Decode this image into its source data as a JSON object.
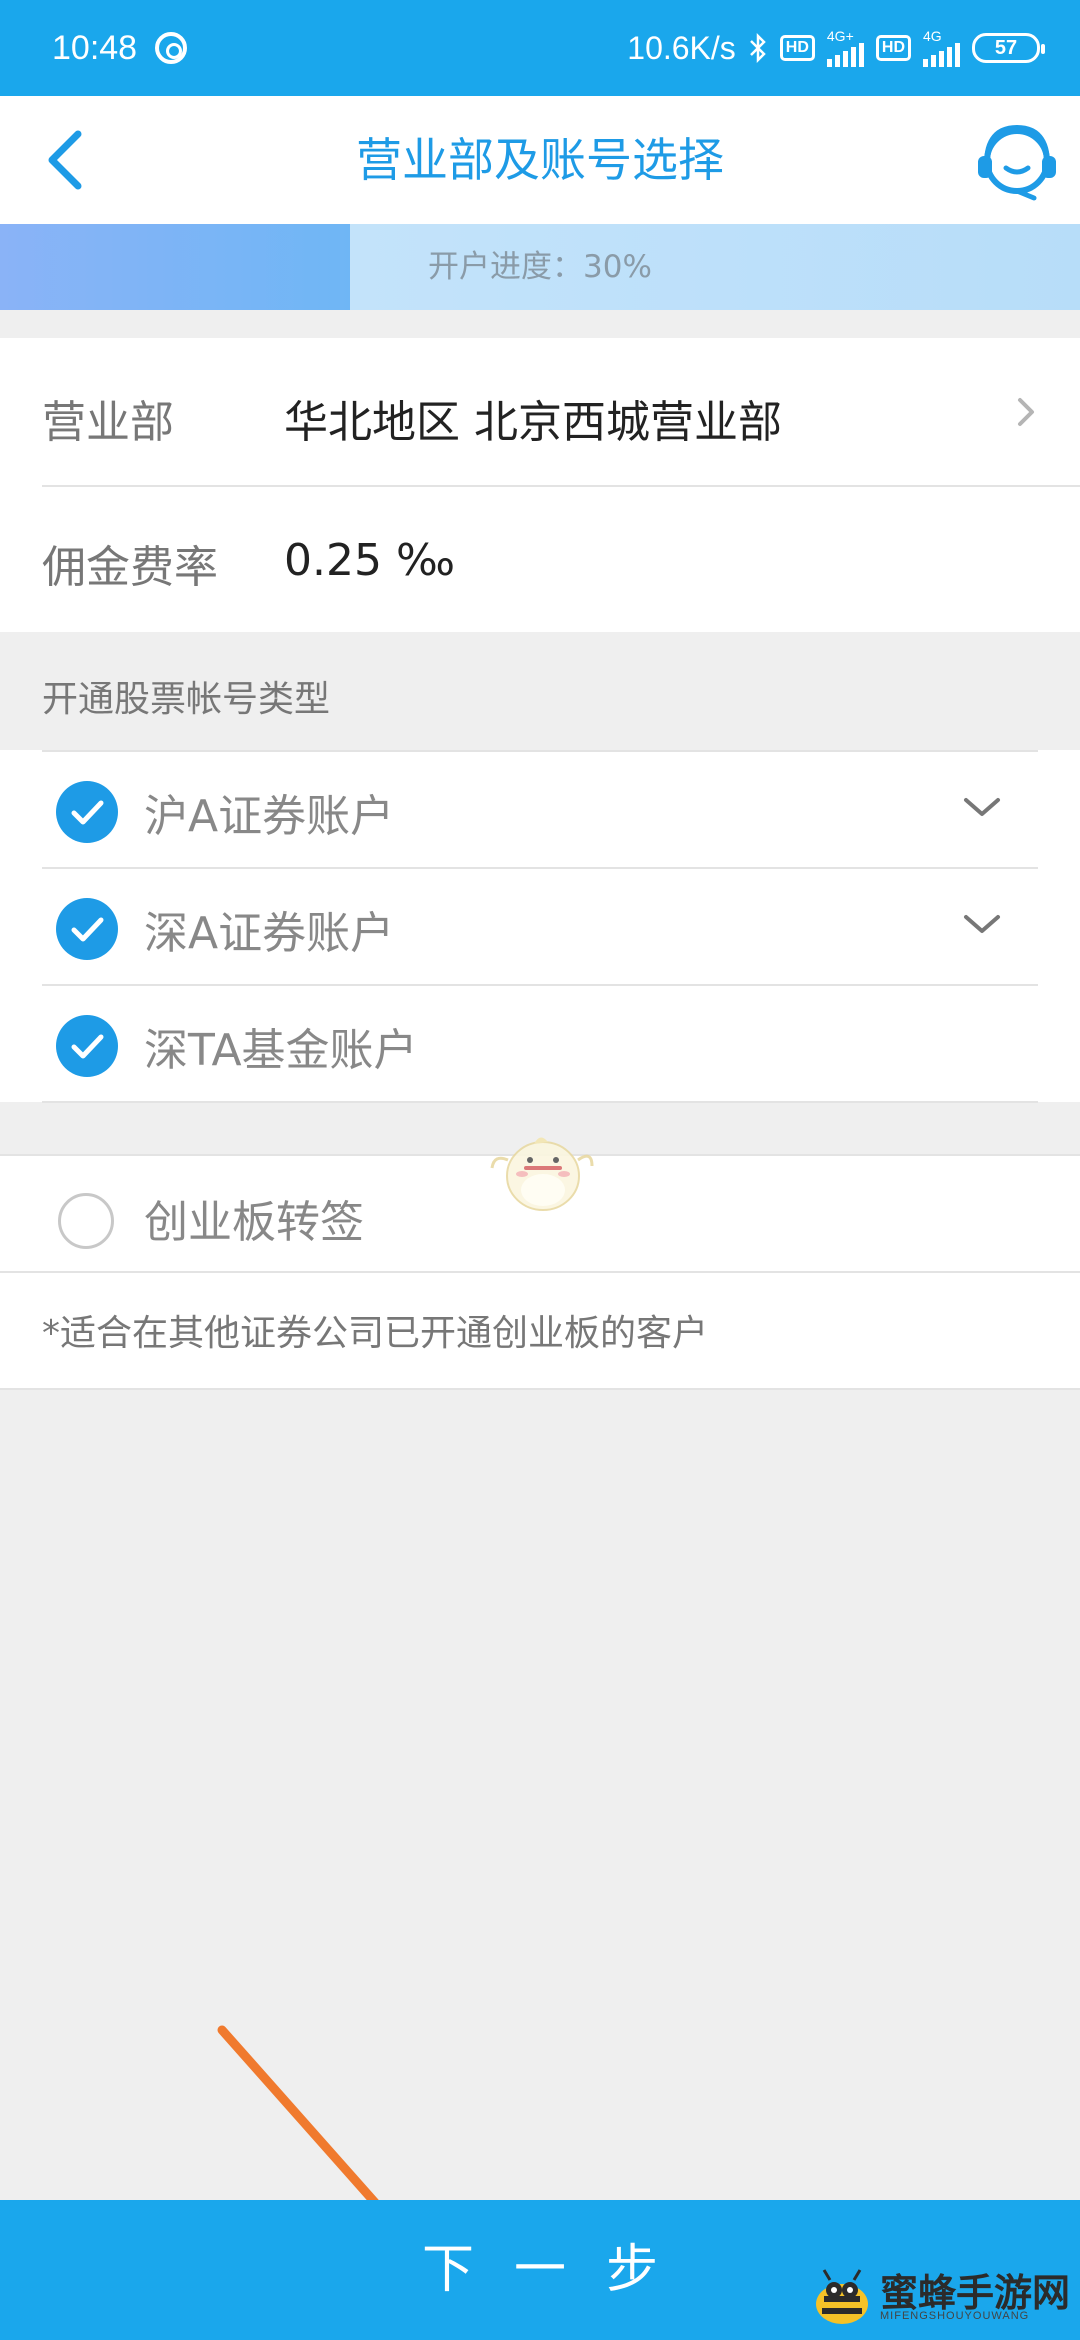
{
  "status_bar": {
    "time": "10:48",
    "network_speed": "10.6K/s",
    "sim1_label": "4G+",
    "sim2_label": "4G",
    "hd_label": "HD",
    "battery": "57"
  },
  "header": {
    "title": "营业部及账号选择"
  },
  "progress": {
    "label": "开户进度：30%",
    "value": 0.3
  },
  "branch": {
    "label": "营业部",
    "value": "华北地区 北京西城营业部"
  },
  "commission": {
    "label": "佣金费率",
    "value": "0.25 ‰"
  },
  "account_types": {
    "title": "开通股票帐号类型",
    "items": [
      {
        "label": "沪A证券账户",
        "checked": true,
        "expandable": true
      },
      {
        "label": "深A证券账户",
        "checked": true,
        "expandable": true
      },
      {
        "label": "深TA基金账户",
        "checked": true,
        "expandable": false
      }
    ]
  },
  "chinext": {
    "label": "创业板转签",
    "checked": false,
    "note": "*适合在其他证券公司已开通创业板的客户"
  },
  "footer": {
    "next_label": "下一步"
  },
  "watermark": {
    "text": "蜜蜂手游网",
    "sub": "MIFENGSHOUYOUWANG"
  },
  "colors": {
    "accent": "#1e9be6",
    "bar": "#1aa7ec",
    "annotation_arrow": "#f07a2e"
  }
}
